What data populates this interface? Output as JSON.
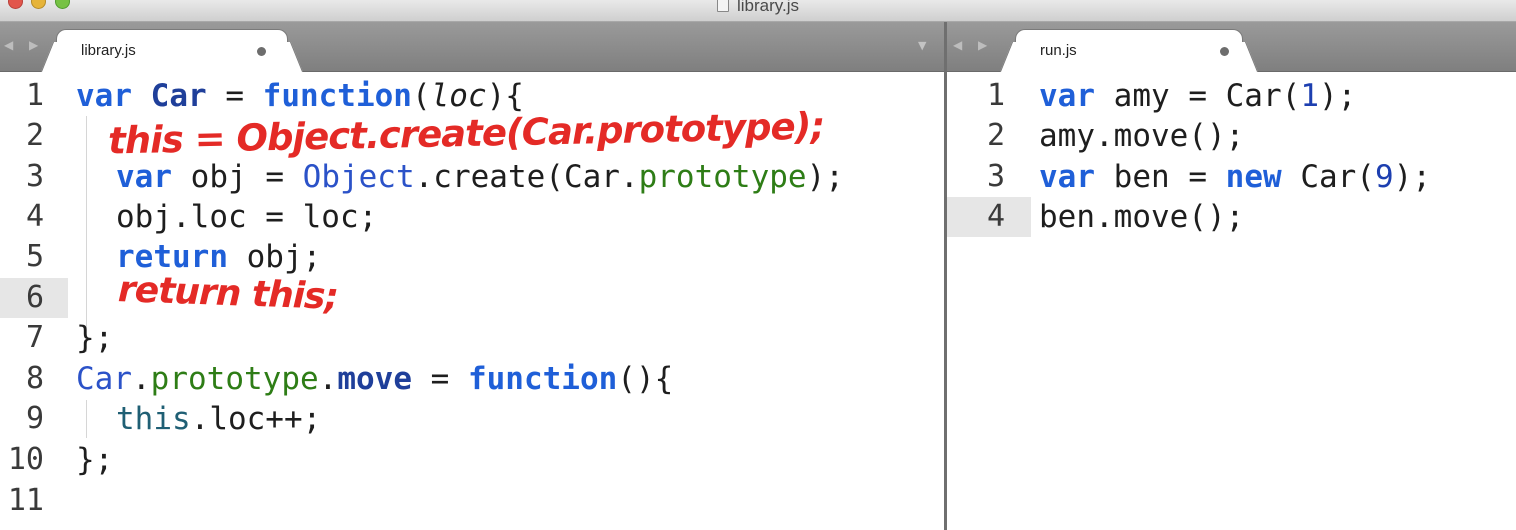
{
  "window": {
    "title": "library.js"
  },
  "left_pane": {
    "nav_arrows": "◀ ▶",
    "dropdown": "▼",
    "tab": {
      "label": "library.js",
      "modified": true
    },
    "lines": [
      {
        "n": "1"
      },
      {
        "n": "2"
      },
      {
        "n": "3"
      },
      {
        "n": "4"
      },
      {
        "n": "5"
      },
      {
        "n": "6"
      },
      {
        "n": "7"
      },
      {
        "n": "8"
      },
      {
        "n": "9"
      },
      {
        "n": "10"
      },
      {
        "n": "11"
      }
    ],
    "code": {
      "l1": {
        "a": "var",
        "b": " Car",
        "c": " = ",
        "d": "function",
        "e": "(",
        "f": "loc",
        "g": "){"
      },
      "l3": {
        "a": "var",
        "b": " obj = ",
        "c": "Object",
        "d": ".create(Car.",
        "e": "prototype",
        "f": ");"
      },
      "l4": {
        "a": "obj.loc = loc;"
      },
      "l5": {
        "a": "return",
        "b": " obj;"
      },
      "l7": {
        "a": "};"
      },
      "l8": {
        "a": "Car",
        "b": ".",
        "c": "prototype",
        "d": ".",
        "e": "move",
        "f": " = ",
        "g": "function",
        "h": "(){"
      },
      "l9": {
        "a": "this",
        "b": ".loc++;"
      },
      "l10": {
        "a": "};"
      }
    },
    "handwriting": {
      "line2": "this = Object.create(Car.prototype);",
      "line6": "return this;"
    }
  },
  "right_pane": {
    "nav_arrows": "◀ ▶",
    "tab": {
      "label": "run.js",
      "modified": true
    },
    "lines": [
      {
        "n": "1"
      },
      {
        "n": "2"
      },
      {
        "n": "3"
      },
      {
        "n": "4"
      }
    ],
    "code": {
      "l1": {
        "a": "var",
        "b": " amy = Car(",
        "c": "1",
        "d": ");"
      },
      "l2": {
        "a": "amy.move();"
      },
      "l3": {
        "a": "var",
        "b": " ben = ",
        "c": "new",
        "d": " Car(",
        "e": "9",
        "f": ");"
      },
      "l4": {
        "a": "ben.move();"
      }
    }
  },
  "colors": {
    "keyword": "#1f5fd8",
    "property": "#2e7d16",
    "handwriting": "#e42a26"
  }
}
